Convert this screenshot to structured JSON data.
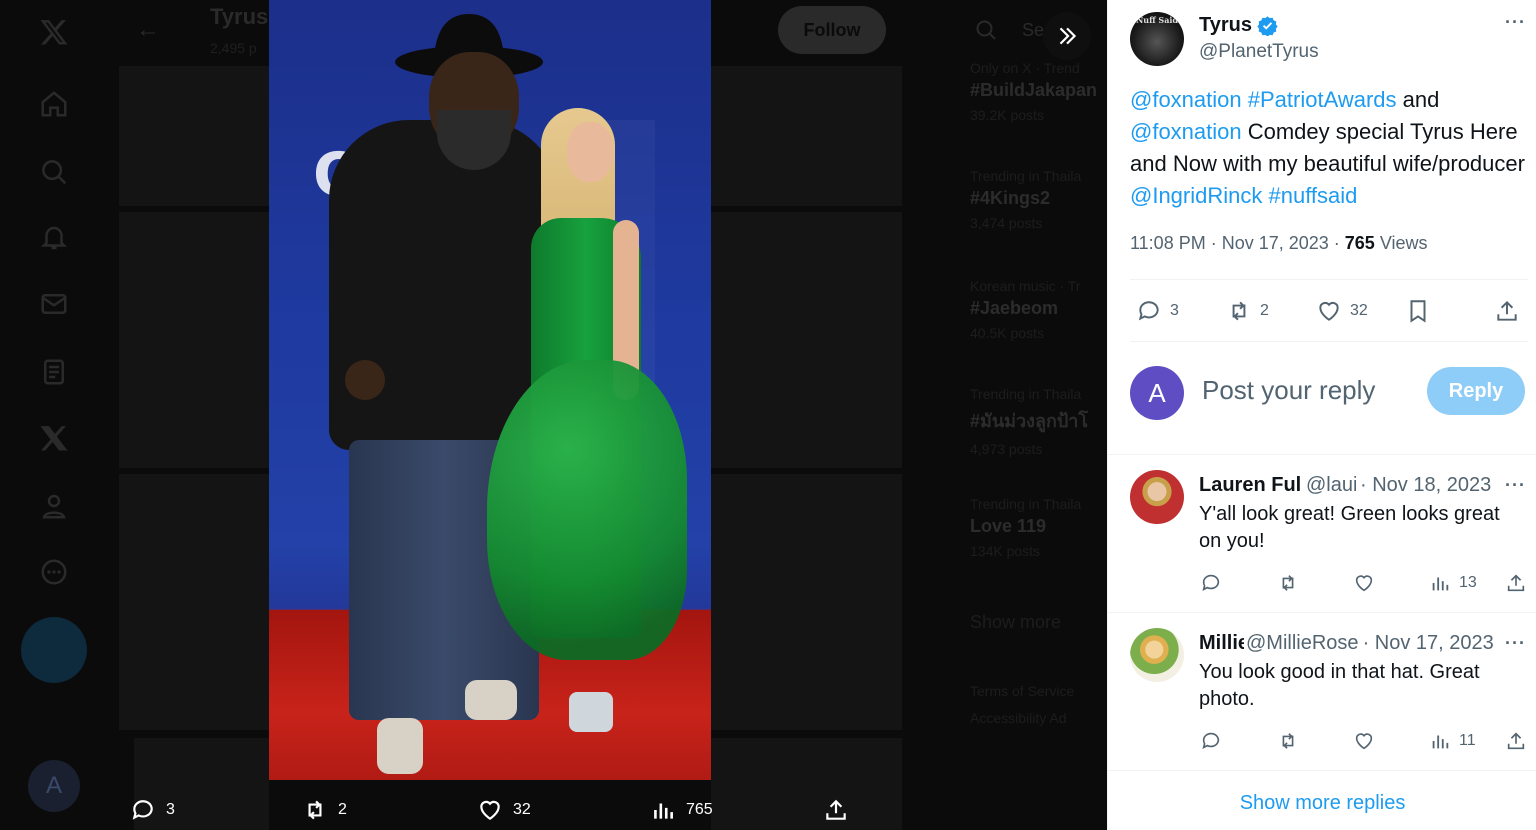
{
  "background": {
    "header_title": "Tyrus",
    "header_subtitle": "2,495 p",
    "follow_label": "Follow",
    "search_placeholder": "Se",
    "trends": [
      {
        "context": "Only on X · Trend",
        "tag": "#BuildJakapan",
        "count": "39.2K posts"
      },
      {
        "context": "Trending in Thaila",
        "tag": "#4Kings2",
        "count": "3,474 posts"
      },
      {
        "context": "Korean music · Tr",
        "tag": "#Jaebeom",
        "count": "40.5K posts"
      },
      {
        "context": "Trending in Thaila",
        "tag": "#มันม่วงลูกป้าโ",
        "count": "4,973 posts"
      },
      {
        "context": "Trending in Thaila",
        "tag": "Love 119",
        "count": "134K posts"
      }
    ],
    "show_more": "Show more",
    "footer_line1": "Terms of Service",
    "footer_line2": "Accessibility   Ad",
    "account_initial": "A"
  },
  "media": {
    "photo_logo_text": "OX",
    "actions": {
      "replies": "3",
      "reposts": "2",
      "likes": "32",
      "views": "765"
    }
  },
  "tweet": {
    "author_name": "Tyrus",
    "author_handle": "@PlanetTyrus",
    "avatar_text": "Nuff Said",
    "text": {
      "m1": "@foxnation",
      "h1": "#PatriotAwards",
      "t1": " and ",
      "m2": "@foxnation",
      "t2": " Comdey special Tyrus Here and Now with my beautiful wife/producer ",
      "m3": "@IngridRinck",
      "h2": "#nuffsaid"
    },
    "time": "11:08 PM · Nov 17, 2023 · ",
    "views_count": "765",
    "views_label": "Views",
    "stats": {
      "replies": "3",
      "reposts": "2",
      "likes": "32"
    }
  },
  "reply_box": {
    "avatar_initial": "A",
    "placeholder": "Post your reply",
    "button_label": "Reply"
  },
  "comments": [
    {
      "name": "Lauren Fult",
      "handle": "@laui",
      "date": "· Nov 18, 2023",
      "text": "Y'all look great! Green looks great on you!",
      "views": "13"
    },
    {
      "name": "Millie",
      "handle": "@MillieRose",
      "date": "· Nov 17, 2023",
      "text": "You look good in that hat.  Great photo.",
      "views": "11"
    }
  ],
  "show_more_replies": "Show more replies",
  "colors": {
    "accent": "#1d9bf0",
    "reply_button": "#8ecdf7",
    "secondary_text": "#536471"
  }
}
